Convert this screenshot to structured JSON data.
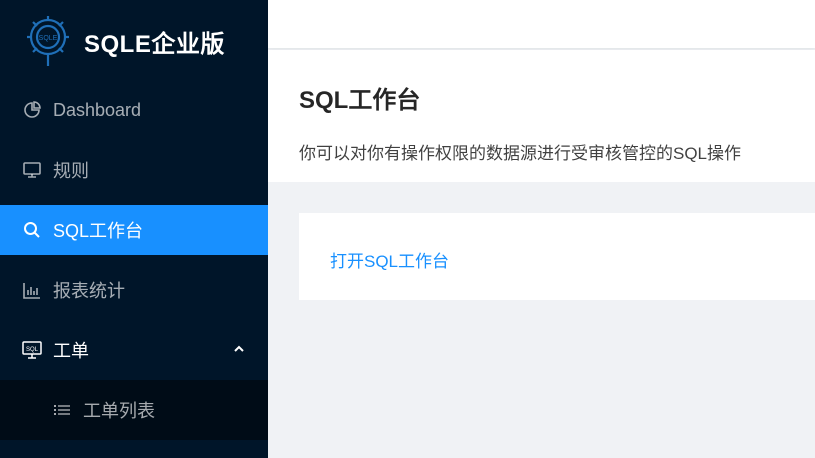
{
  "app": {
    "title": "SQLE企业版",
    "logo_text": "SQLE"
  },
  "sidebar": {
    "items": [
      {
        "label": "Dashboard",
        "icon": "pie-chart-icon"
      },
      {
        "label": "规则",
        "icon": "monitor-icon"
      },
      {
        "label": "SQL工作台",
        "icon": "search-icon",
        "active": true
      },
      {
        "label": "报表统计",
        "icon": "bar-chart-icon"
      },
      {
        "label": "工单",
        "icon": "sql-workorder-icon",
        "expanded": true
      },
      {
        "label": "工单列表",
        "icon": "list-icon"
      }
    ]
  },
  "page": {
    "title": "SQL工作台",
    "description": "你可以对你有操作权限的数据源进行受审核管控的SQL操作",
    "open_link": "打开SQL工作台"
  },
  "colors": {
    "sidebar_bg": "#001529",
    "submenu_bg": "#000c17",
    "active": "#1890ff",
    "content_bg": "#f0f2f5"
  }
}
